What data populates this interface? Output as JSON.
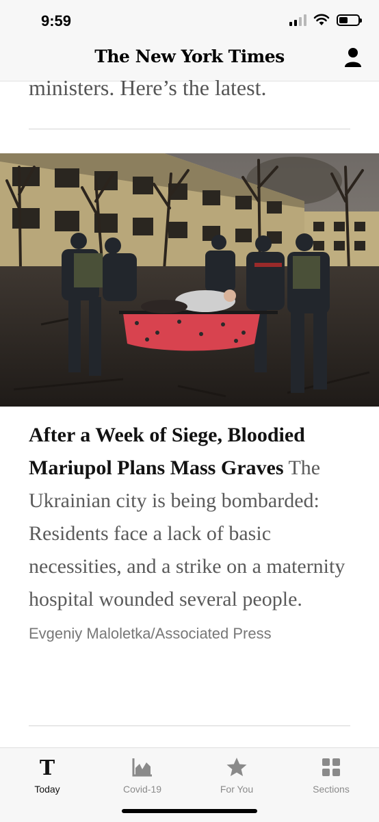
{
  "status_bar": {
    "time": "9:59"
  },
  "header": {
    "masthead": "The New York Times",
    "account_icon": "person-icon"
  },
  "previous_article": {
    "snippet": "ministers. Here’s the latest."
  },
  "article": {
    "headline": "After a Week of Siege, Bloodied Mariupol Plans Mass Graves",
    "summary": "The Ukrainian city is being bombarded: Residents face a lack of basic necessities, and a strike on a maternity hospital wounded several people.",
    "photo_credit": "Evgeniy Maloletka/Associated Press"
  },
  "tab_bar": {
    "tabs": [
      {
        "label": "Today",
        "icon": "nyt-t-logo-icon",
        "active": true
      },
      {
        "label": "Covid-19",
        "icon": "chart-icon",
        "active": false
      },
      {
        "label": "For You",
        "icon": "star-icon",
        "active": false
      },
      {
        "label": "Sections",
        "icon": "grid-icon",
        "active": false
      }
    ]
  },
  "colors": {
    "bar_background": "#f7f7f7",
    "headline": "#121212",
    "summary": "#5a5a5a",
    "inactive_tab": "#8a8a8a"
  }
}
